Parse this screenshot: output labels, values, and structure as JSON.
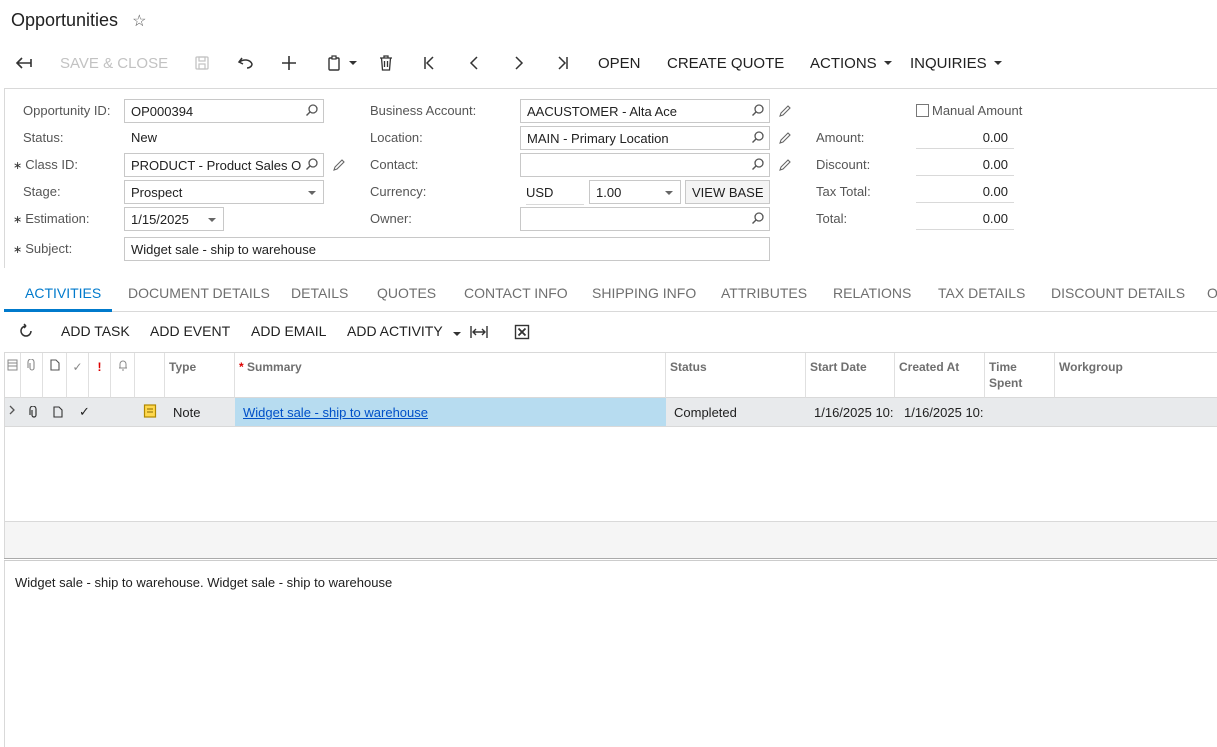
{
  "page": {
    "title": "Opportunities"
  },
  "toolbar": {
    "save_close": "SAVE & CLOSE",
    "open": "OPEN",
    "create_quote": "CREATE QUOTE",
    "actions": "ACTIONS",
    "inquiries": "INQUIRIES"
  },
  "form": {
    "opportunity_id": {
      "label": "Opportunity ID:",
      "value": "OP000394"
    },
    "status": {
      "label": "Status:",
      "value": "New"
    },
    "class_id": {
      "label": "Class ID:",
      "value": "PRODUCT - Product Sales O"
    },
    "stage": {
      "label": "Stage:",
      "value": "Prospect"
    },
    "estimation": {
      "label": "Estimation:",
      "value": "1/15/2025"
    },
    "subject": {
      "label": "Subject:",
      "value": "Widget sale - ship to warehouse"
    },
    "business_account": {
      "label": "Business Account:",
      "value": "AACUSTOMER - Alta Ace"
    },
    "location": {
      "label": "Location:",
      "value": "MAIN - Primary Location"
    },
    "contact": {
      "label": "Contact:",
      "value": ""
    },
    "currency": {
      "label": "Currency:",
      "value": "USD",
      "rate": "1.00",
      "view_base": "VIEW BASE"
    },
    "owner": {
      "label": "Owner:",
      "value": ""
    },
    "manual_amount": {
      "label": "Manual Amount",
      "checked": false
    },
    "amount": {
      "label": "Amount:",
      "value": "0.00"
    },
    "discount": {
      "label": "Discount:",
      "value": "0.00"
    },
    "tax_total": {
      "label": "Tax Total:",
      "value": "0.00"
    },
    "total": {
      "label": "Total:",
      "value": "0.00"
    }
  },
  "tabs": [
    "ACTIVITIES",
    "DOCUMENT DETAILS",
    "DETAILS",
    "QUOTES",
    "CONTACT INFO",
    "SHIPPING INFO",
    "ATTRIBUTES",
    "RELATIONS",
    "TAX DETAILS",
    "DISCOUNT DETAILS",
    "O"
  ],
  "grid_toolbar": {
    "add_task": "ADD TASK",
    "add_event": "ADD EVENT",
    "add_email": "ADD EMAIL",
    "add_activity": "ADD ACTIVITY"
  },
  "grid": {
    "headers": {
      "type": "Type",
      "summary": "Summary",
      "status": "Status",
      "start_date": "Start Date",
      "created_at": "Created At",
      "time_spent_1": "Time",
      "time_spent_2": "Spent",
      "workgroup": "Workgroup"
    },
    "rows": [
      {
        "type": "Note",
        "summary": "Widget sale - ship to warehouse",
        "status": "Completed",
        "start_date": "1/16/2025 10:",
        "created_at": "1/16/2025 10:"
      }
    ]
  },
  "note_body": "Widget sale - ship to warehouse. Widget sale - ship to warehouse",
  "colors": {
    "accent": "#007acc",
    "selected_cell": "#b7dcf0",
    "row_bg": "#e8eaec",
    "link": "#0050c8"
  }
}
